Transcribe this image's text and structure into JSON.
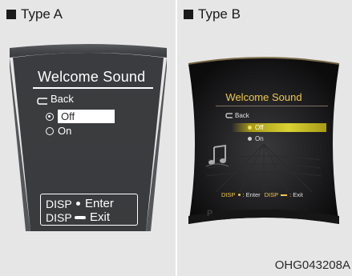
{
  "panels": [
    {
      "header": "Type A",
      "screen": {
        "title": "Welcome Sound",
        "back_label": "Back",
        "options": [
          {
            "label": "Off",
            "selected": true
          },
          {
            "label": "On",
            "selected": false
          }
        ],
        "keys": [
          {
            "button": "DISP",
            "action": "Enter",
            "icon": "dot-icon"
          },
          {
            "button": "DISP",
            "action": "Exit",
            "icon": "dash-icon"
          }
        ]
      }
    },
    {
      "header": "Type B",
      "screen": {
        "title": "Welcome Sound",
        "back_label": "Back",
        "options": [
          {
            "label": "Off",
            "selected": true
          },
          {
            "label": "On",
            "selected": false
          }
        ],
        "footer": {
          "enter_button": "DISP",
          "enter_text": ": Enter",
          "exit_button": "DISP",
          "exit_text": ": Exit"
        },
        "gear_indicator": "P"
      }
    }
  ],
  "figure_code": "OHG043208A",
  "colors": {
    "background": "#e6e6e7",
    "type_a_screen": "#3a3b3d",
    "type_b_title": "#f0c84a",
    "type_b_highlight": "#dad234"
  }
}
